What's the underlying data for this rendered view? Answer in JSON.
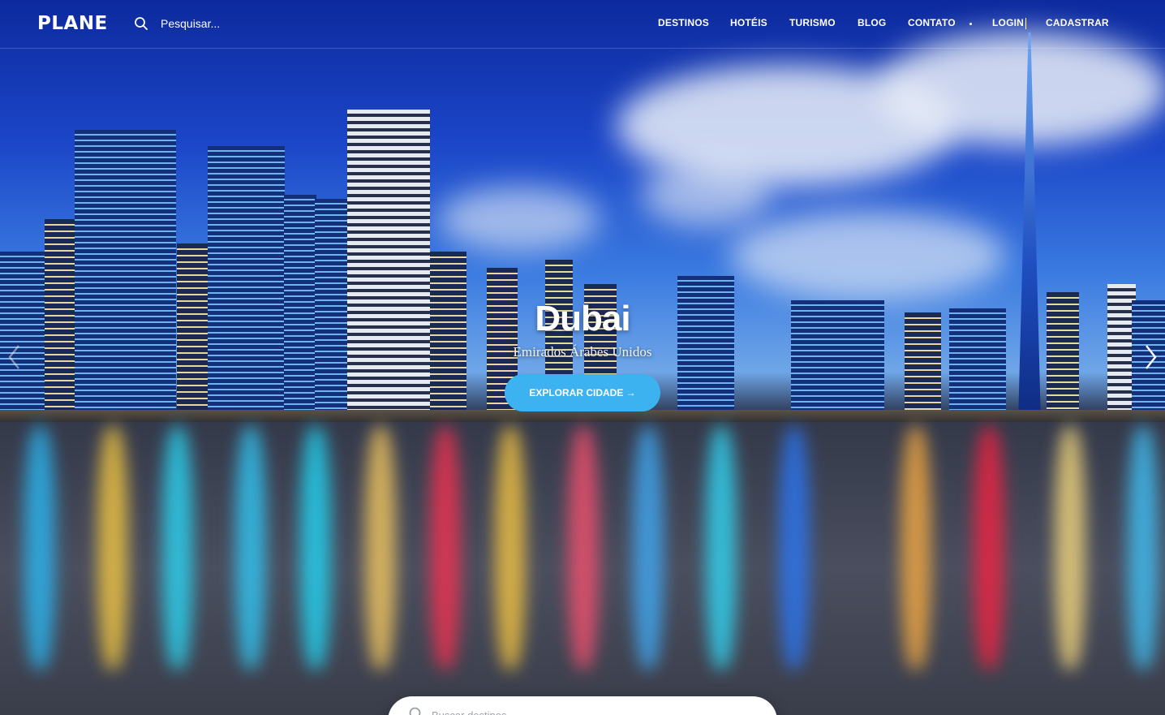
{
  "header": {
    "logo": "PLANE",
    "search_placeholder": "Pesquisar...",
    "nav": [
      "DESTINOS",
      "HOTÉIS",
      "TURISMO",
      "BLOG",
      "CONTATO",
      "LOGIN",
      "CADASTRAR"
    ]
  },
  "hero": {
    "city": "Dubai",
    "country": "Emirados Árabes Unidos",
    "cta_label": "EXPLORAR CIDADE →"
  },
  "destination_search": {
    "placeholder": "Buscar destinos"
  },
  "icons": {
    "search": "search-icon",
    "prev": "chevron-left-icon",
    "next": "chevron-right-icon"
  },
  "colors": {
    "accent": "#3cb3f0"
  }
}
